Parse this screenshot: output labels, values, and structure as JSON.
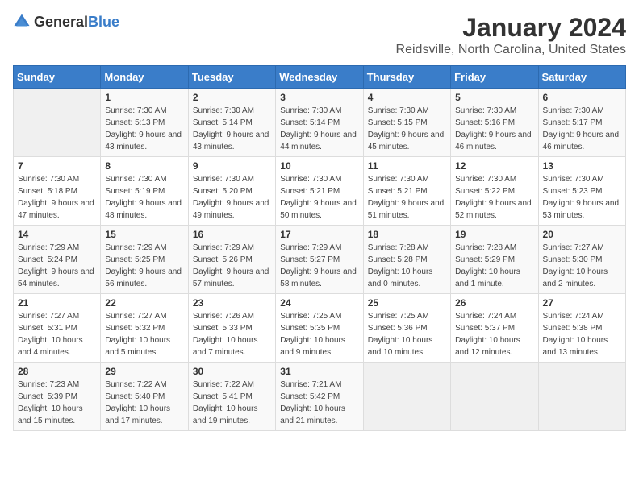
{
  "header": {
    "logo_general": "General",
    "logo_blue": "Blue",
    "month": "January 2024",
    "location": "Reidsville, North Carolina, United States"
  },
  "weekdays": [
    "Sunday",
    "Monday",
    "Tuesday",
    "Wednesday",
    "Thursday",
    "Friday",
    "Saturday"
  ],
  "weeks": [
    [
      {
        "day": "",
        "sunrise": "",
        "sunset": "",
        "daylight": ""
      },
      {
        "day": "1",
        "sunrise": "Sunrise: 7:30 AM",
        "sunset": "Sunset: 5:13 PM",
        "daylight": "Daylight: 9 hours and 43 minutes."
      },
      {
        "day": "2",
        "sunrise": "Sunrise: 7:30 AM",
        "sunset": "Sunset: 5:14 PM",
        "daylight": "Daylight: 9 hours and 43 minutes."
      },
      {
        "day": "3",
        "sunrise": "Sunrise: 7:30 AM",
        "sunset": "Sunset: 5:14 PM",
        "daylight": "Daylight: 9 hours and 44 minutes."
      },
      {
        "day": "4",
        "sunrise": "Sunrise: 7:30 AM",
        "sunset": "Sunset: 5:15 PM",
        "daylight": "Daylight: 9 hours and 45 minutes."
      },
      {
        "day": "5",
        "sunrise": "Sunrise: 7:30 AM",
        "sunset": "Sunset: 5:16 PM",
        "daylight": "Daylight: 9 hours and 46 minutes."
      },
      {
        "day": "6",
        "sunrise": "Sunrise: 7:30 AM",
        "sunset": "Sunset: 5:17 PM",
        "daylight": "Daylight: 9 hours and 46 minutes."
      }
    ],
    [
      {
        "day": "7",
        "sunrise": "Sunrise: 7:30 AM",
        "sunset": "Sunset: 5:18 PM",
        "daylight": "Daylight: 9 hours and 47 minutes."
      },
      {
        "day": "8",
        "sunrise": "Sunrise: 7:30 AM",
        "sunset": "Sunset: 5:19 PM",
        "daylight": "Daylight: 9 hours and 48 minutes."
      },
      {
        "day": "9",
        "sunrise": "Sunrise: 7:30 AM",
        "sunset": "Sunset: 5:20 PM",
        "daylight": "Daylight: 9 hours and 49 minutes."
      },
      {
        "day": "10",
        "sunrise": "Sunrise: 7:30 AM",
        "sunset": "Sunset: 5:21 PM",
        "daylight": "Daylight: 9 hours and 50 minutes."
      },
      {
        "day": "11",
        "sunrise": "Sunrise: 7:30 AM",
        "sunset": "Sunset: 5:21 PM",
        "daylight": "Daylight: 9 hours and 51 minutes."
      },
      {
        "day": "12",
        "sunrise": "Sunrise: 7:30 AM",
        "sunset": "Sunset: 5:22 PM",
        "daylight": "Daylight: 9 hours and 52 minutes."
      },
      {
        "day": "13",
        "sunrise": "Sunrise: 7:30 AM",
        "sunset": "Sunset: 5:23 PM",
        "daylight": "Daylight: 9 hours and 53 minutes."
      }
    ],
    [
      {
        "day": "14",
        "sunrise": "Sunrise: 7:29 AM",
        "sunset": "Sunset: 5:24 PM",
        "daylight": "Daylight: 9 hours and 54 minutes."
      },
      {
        "day": "15",
        "sunrise": "Sunrise: 7:29 AM",
        "sunset": "Sunset: 5:25 PM",
        "daylight": "Daylight: 9 hours and 56 minutes."
      },
      {
        "day": "16",
        "sunrise": "Sunrise: 7:29 AM",
        "sunset": "Sunset: 5:26 PM",
        "daylight": "Daylight: 9 hours and 57 minutes."
      },
      {
        "day": "17",
        "sunrise": "Sunrise: 7:29 AM",
        "sunset": "Sunset: 5:27 PM",
        "daylight": "Daylight: 9 hours and 58 minutes."
      },
      {
        "day": "18",
        "sunrise": "Sunrise: 7:28 AM",
        "sunset": "Sunset: 5:28 PM",
        "daylight": "Daylight: 10 hours and 0 minutes."
      },
      {
        "day": "19",
        "sunrise": "Sunrise: 7:28 AM",
        "sunset": "Sunset: 5:29 PM",
        "daylight": "Daylight: 10 hours and 1 minute."
      },
      {
        "day": "20",
        "sunrise": "Sunrise: 7:27 AM",
        "sunset": "Sunset: 5:30 PM",
        "daylight": "Daylight: 10 hours and 2 minutes."
      }
    ],
    [
      {
        "day": "21",
        "sunrise": "Sunrise: 7:27 AM",
        "sunset": "Sunset: 5:31 PM",
        "daylight": "Daylight: 10 hours and 4 minutes."
      },
      {
        "day": "22",
        "sunrise": "Sunrise: 7:27 AM",
        "sunset": "Sunset: 5:32 PM",
        "daylight": "Daylight: 10 hours and 5 minutes."
      },
      {
        "day": "23",
        "sunrise": "Sunrise: 7:26 AM",
        "sunset": "Sunset: 5:33 PM",
        "daylight": "Daylight: 10 hours and 7 minutes."
      },
      {
        "day": "24",
        "sunrise": "Sunrise: 7:25 AM",
        "sunset": "Sunset: 5:35 PM",
        "daylight": "Daylight: 10 hours and 9 minutes."
      },
      {
        "day": "25",
        "sunrise": "Sunrise: 7:25 AM",
        "sunset": "Sunset: 5:36 PM",
        "daylight": "Daylight: 10 hours and 10 minutes."
      },
      {
        "day": "26",
        "sunrise": "Sunrise: 7:24 AM",
        "sunset": "Sunset: 5:37 PM",
        "daylight": "Daylight: 10 hours and 12 minutes."
      },
      {
        "day": "27",
        "sunrise": "Sunrise: 7:24 AM",
        "sunset": "Sunset: 5:38 PM",
        "daylight": "Daylight: 10 hours and 13 minutes."
      }
    ],
    [
      {
        "day": "28",
        "sunrise": "Sunrise: 7:23 AM",
        "sunset": "Sunset: 5:39 PM",
        "daylight": "Daylight: 10 hours and 15 minutes."
      },
      {
        "day": "29",
        "sunrise": "Sunrise: 7:22 AM",
        "sunset": "Sunset: 5:40 PM",
        "daylight": "Daylight: 10 hours and 17 minutes."
      },
      {
        "day": "30",
        "sunrise": "Sunrise: 7:22 AM",
        "sunset": "Sunset: 5:41 PM",
        "daylight": "Daylight: 10 hours and 19 minutes."
      },
      {
        "day": "31",
        "sunrise": "Sunrise: 7:21 AM",
        "sunset": "Sunset: 5:42 PM",
        "daylight": "Daylight: 10 hours and 21 minutes."
      },
      {
        "day": "",
        "sunrise": "",
        "sunset": "",
        "daylight": ""
      },
      {
        "day": "",
        "sunrise": "",
        "sunset": "",
        "daylight": ""
      },
      {
        "day": "",
        "sunrise": "",
        "sunset": "",
        "daylight": ""
      }
    ]
  ]
}
